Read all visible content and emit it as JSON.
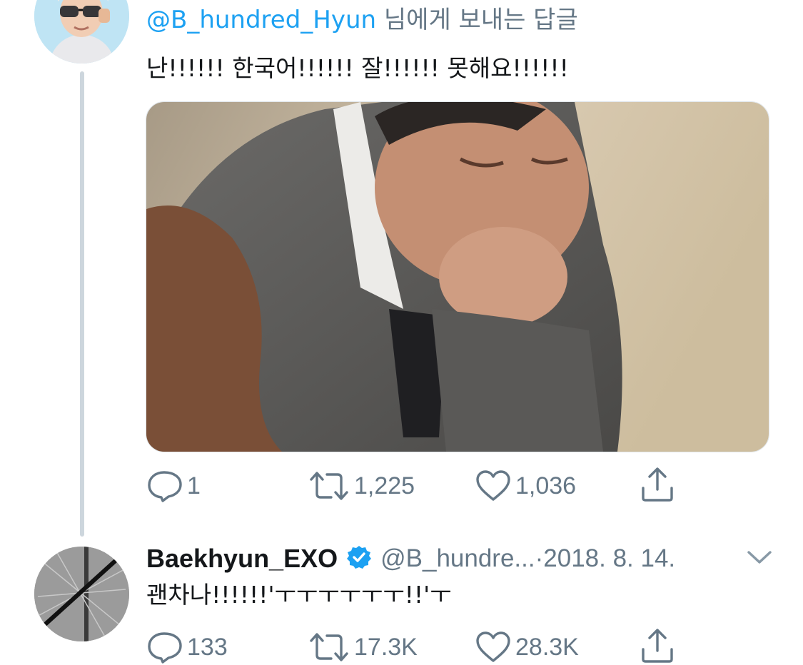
{
  "first_tweet": {
    "reply_to_handle": "@B_hundred_Hyun",
    "reply_to_suffix": " 님에게 보내는 답글",
    "text": "난!!!!!! 한국어!!!!!! 잘!!!!!! 못해요!!!!!!",
    "actions": {
      "replies": "1",
      "retweets": "1,225",
      "likes": "1,036"
    }
  },
  "second_tweet": {
    "display_name": "Baekhyun_EXO",
    "handle": "@B_hundre...",
    "separator": " · ",
    "date": "2018. 8. 14.",
    "text": "괜차나!!!!!!'ㅜㅜㅜㅜㅜㅜ!!'ㅜ",
    "actions": {
      "replies": "133",
      "retweets": "17.3K",
      "likes": "28.3K"
    }
  },
  "icons": {
    "reply": "speech-bubble-icon",
    "retweet": "retweet-arrows-icon",
    "like": "heart-icon",
    "share": "share-upload-icon",
    "verified": "verified-badge-icon",
    "more": "chevron-down-icon"
  },
  "colors": {
    "twitter_blue": "#1da1f2",
    "secondary_text": "#657786",
    "primary_text": "#14171a",
    "thread_line": "#cdd6dd"
  }
}
